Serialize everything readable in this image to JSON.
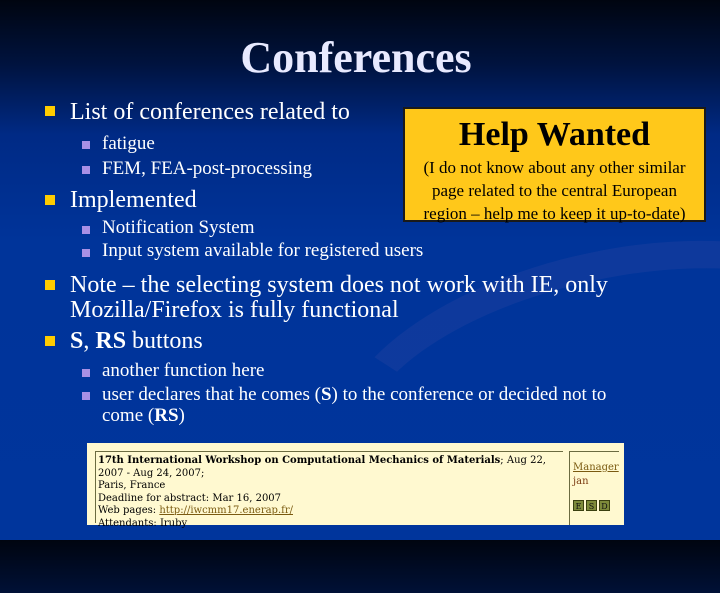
{
  "slide": {
    "title": "Conferences",
    "colors": {
      "background": "#00349a",
      "bullet_l1": "#ffcc00",
      "bullet_l2": "#a890e6",
      "help_box": "#ffc81a",
      "conf_box": "#fff9d0"
    }
  },
  "bullets": [
    {
      "text": "List of conferences related to",
      "sub": [
        "fatigue",
        "FEM, FEA-post-processing"
      ]
    },
    {
      "text": "Implemented",
      "sub": [
        "Notification System",
        "Input system available for registered users"
      ]
    },
    {
      "text_line1": "Note – the selecting system does not work with IE, only",
      "text_line2": "Mozilla/Firefox is fully functional"
    },
    {
      "text_bold_1": "S",
      "text_sep": ", ",
      "text_bold_2": "RS",
      "text_rest": " buttons",
      "sub": [
        {
          "text": "another function here"
        },
        {
          "pre": "user declares that he comes (",
          "b1": "S",
          "mid": ") to the conference or decided not to",
          "line2_pre": "come (",
          "b2": "RS",
          "line2_post": ")"
        }
      ]
    }
  ],
  "help_wanted": {
    "title": "Help Wanted",
    "line1": "(I do not know about any other similar",
    "line2": "page related to the central European",
    "line3": "region – help me to keep it up-to-date)"
  },
  "conference_entry": {
    "title": "17th International Workshop on Computational Mechanics of Materials",
    "dates": "; Aug 22, 2007 - Aug 24, 2007;",
    "location": "Paris, France",
    "deadline": "Deadline for abstract: Mar 16, 2007",
    "webpage_label": "Web pages: ",
    "webpage_url": "http://iwcmm17.enerap.fr/",
    "attendants": "Attendants: Iruby",
    "manager_label": "Manager",
    "manager_name": "jan",
    "buttons": [
      {
        "icon": "edit-icon",
        "glyph": "E"
      },
      {
        "icon": "s-icon",
        "glyph": "S"
      },
      {
        "icon": "rs-icon",
        "glyph": "D"
      }
    ]
  }
}
